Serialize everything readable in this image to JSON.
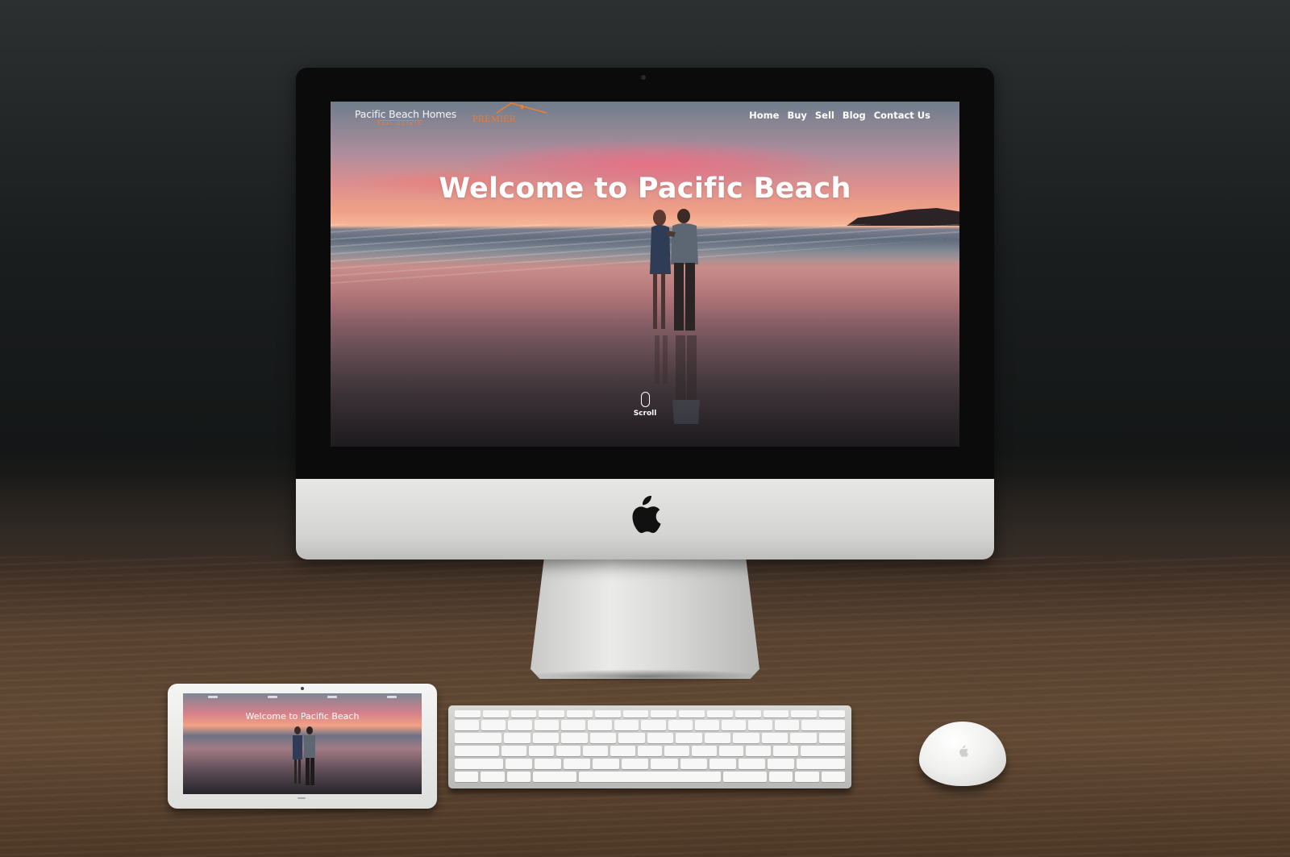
{
  "site": {
    "logo_main": "Pacific Beach Homes",
    "logo_sub": "REAL ESTATE",
    "logo_partner": "PREMIER",
    "nav": [
      "Home",
      "Buy",
      "Sell",
      "Blog",
      "Contact Us"
    ],
    "hero_title": "Welcome to Pacific Beach",
    "scroll_label": "Scroll"
  },
  "tablet": {
    "hero_title": "Welcome to Pacific Beach"
  },
  "icons": {
    "brand": "apple-icon",
    "scroll": "mouse-scroll-icon"
  },
  "colors": {
    "accent": "#ef7d2b",
    "nav_text": "#ffffff"
  }
}
